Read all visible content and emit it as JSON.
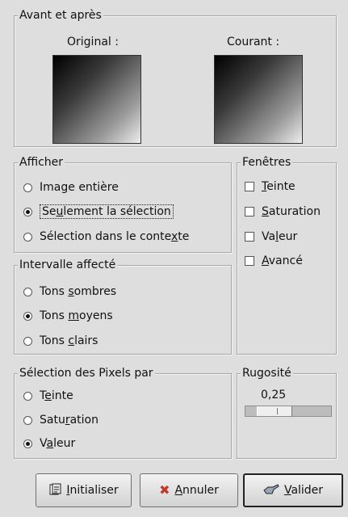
{
  "preview": {
    "title": "Avant et après",
    "original_label": "Original :",
    "current_label": "Courant :"
  },
  "afficher": {
    "title": "Afficher",
    "options": [
      {
        "pre": "Ima",
        "u": "g",
        "post": "e entière",
        "selected": false
      },
      {
        "pre": "Se",
        "u": "u",
        "post": "lement la sélection",
        "selected": true
      },
      {
        "pre": "Sélection dans le conte",
        "u": "x",
        "post": "te",
        "selected": false
      }
    ]
  },
  "fenetres": {
    "title": "Fenêtres",
    "options": [
      {
        "pre": "",
        "u": "T",
        "post": "einte",
        "checked": false
      },
      {
        "pre": "",
        "u": "S",
        "post": "aturation",
        "checked": false
      },
      {
        "pre": "Va",
        "u": "l",
        "post": "eur",
        "checked": false
      },
      {
        "pre": "",
        "u": "A",
        "post": "vancé",
        "checked": false
      }
    ]
  },
  "intervalle": {
    "title": "Intervalle affecté",
    "options": [
      {
        "pre": "Tons ",
        "u": "s",
        "post": "ombres",
        "selected": false
      },
      {
        "pre": "Tons ",
        "u": "m",
        "post": "oyens",
        "selected": true
      },
      {
        "pre": "Tons ",
        "u": "c",
        "post": "lairs",
        "selected": false
      }
    ]
  },
  "pixels": {
    "title": "Sélection des Pixels par",
    "options": [
      {
        "pre": "T",
        "u": "e",
        "post": "inte",
        "selected": false
      },
      {
        "pre": "Satu",
        "u": "r",
        "post": "ation",
        "selected": false
      },
      {
        "pre": "V",
        "u": "a",
        "post": "leur",
        "selected": true
      }
    ]
  },
  "rugosite": {
    "title": "Rugosité",
    "value_label": "0,25",
    "value": 0.25
  },
  "buttons": {
    "reset": {
      "pre": "",
      "u": "I",
      "post": "nitialiser",
      "icon": "reset-icon"
    },
    "cancel": {
      "pre": "",
      "u": "A",
      "post": "nnuler",
      "icon": "cancel-x-icon"
    },
    "ok": {
      "pre": "",
      "u": "V",
      "post": "alider",
      "icon": "ok-hand-icon"
    }
  },
  "colors": {
    "background": "#dedede",
    "cancel_icon": "#c0392b"
  }
}
